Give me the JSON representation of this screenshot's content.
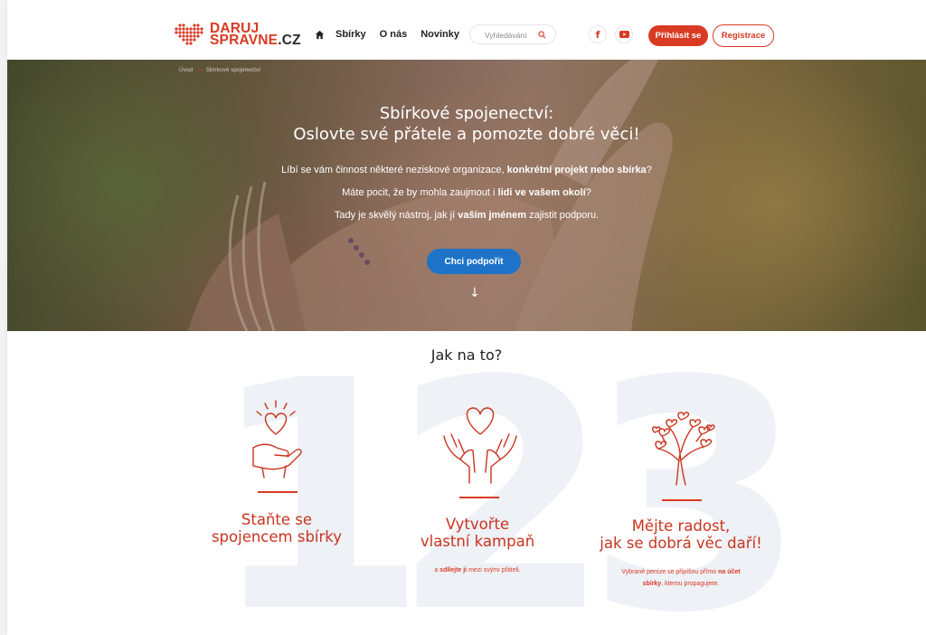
{
  "brand": {
    "line1": "DARUJ",
    "line2": "SPRAVNE",
    "line2_suffix": ".CZ",
    "accent": "#d93a24",
    "blue": "#1e73c8"
  },
  "nav": {
    "home_icon": "home-icon",
    "items": [
      {
        "label": "Sbírky"
      },
      {
        "label": "O nás"
      },
      {
        "label": "Novinky"
      }
    ]
  },
  "search": {
    "placeholder": "Vyhledávání",
    "icon": "search-icon"
  },
  "social": {
    "facebook_icon": "facebook-icon",
    "youtube_icon": "youtube-icon"
  },
  "auth": {
    "login": "Přihlásit se",
    "register": "Registrace"
  },
  "breadcrumb": {
    "home": "Úvod",
    "current": "Sbírkové spojenectví"
  },
  "hero": {
    "title_line1": "Sbírkové spojenectví:",
    "title_line2": "Oslovte své přátele a pomozte dobré věci!",
    "p1_pre": "Líbí se vám činnost některé neziskové organizace, ",
    "p1_bold": "konkrétní projekt nebo sbírka",
    "p1_post": "?",
    "p2_pre": "Máte pocit, že by mohla zaujmout i ",
    "p2_bold": "lidi ve vašem okolí",
    "p2_post": "?",
    "p3_pre": "Tady je skvělý nástroj, jak jí ",
    "p3_bold": "vaším jménem",
    "p3_post": " zajistit podporu.",
    "cta": "Chci podpořit",
    "arrow": "↓"
  },
  "how": {
    "title": "Jak na to?",
    "numbers": [
      "1",
      "2",
      "3"
    ],
    "steps": [
      {
        "title_line1": "Staňte se",
        "title_line2": "spojencem sbírky",
        "icon": "hand-heart-icon"
      },
      {
        "title_line1": "Vytvořte",
        "title_line2": "vlastní kampaň",
        "icon": "hands-heart-icon",
        "desc_pre": "a ",
        "desc_bold": "sdílejte ji",
        "desc_post": " mezi svými přáteli."
      },
      {
        "title_line1": "Mějte radost,",
        "title_line2": "jak se dobrá věc daří!",
        "icon": "heart-tree-icon",
        "desc_line1_pre": "Vybrané peníze se připíšou přímo ",
        "desc_line1_bold": "na účet",
        "desc_line2_bold": "sbírky",
        "desc_line2_post": ", kterou propagujete."
      }
    ]
  }
}
